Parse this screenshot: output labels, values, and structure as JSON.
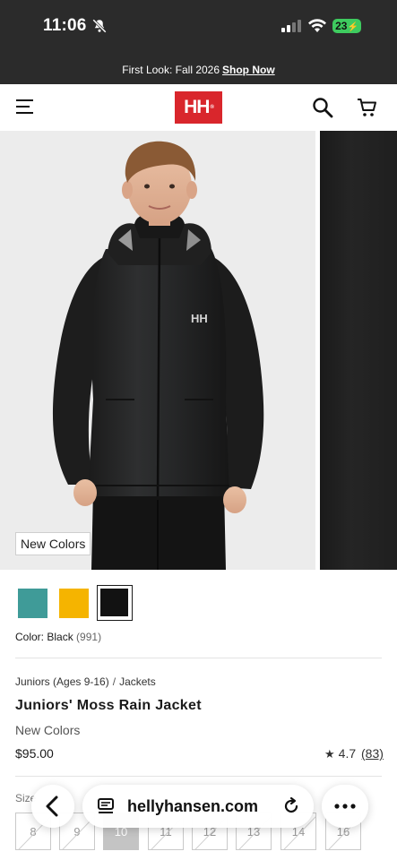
{
  "status_bar": {
    "time": "11:06",
    "battery": "23"
  },
  "promo": {
    "text": "First Look: Fall 2026",
    "link": "Shop Now"
  },
  "header": {
    "logo": "HH"
  },
  "gallery": {
    "badge": "New Colors",
    "jacket_logo": "HH"
  },
  "swatches": [
    {
      "name": "teal",
      "color": "#3f9b98"
    },
    {
      "name": "yellow",
      "color": "#f5b400"
    },
    {
      "name": "black",
      "color": "#121212",
      "selected": true
    }
  ],
  "color": {
    "label": "Color:",
    "value": "Black",
    "code": "(991)"
  },
  "breadcrumb": {
    "category": "Juniors (Ages 9-16)",
    "separator": "/",
    "subcategory": "Jackets"
  },
  "product": {
    "title": "Juniors' Moss Rain Jacket",
    "subtitle": "New Colors",
    "price": "$95.00",
    "rating": "4.7",
    "review_count": "(83)"
  },
  "sizes": {
    "label": "Size",
    "options": [
      {
        "label": "8",
        "available": false
      },
      {
        "label": "9",
        "available": false
      },
      {
        "label": "10",
        "available": true,
        "selected": true
      },
      {
        "label": "11",
        "available": false
      },
      {
        "label": "12",
        "available": false
      },
      {
        "label": "13",
        "available": false
      },
      {
        "label": "14",
        "available": false
      },
      {
        "label": "16",
        "available": false
      }
    ]
  },
  "browser": {
    "url": "hellyhansen.com"
  }
}
